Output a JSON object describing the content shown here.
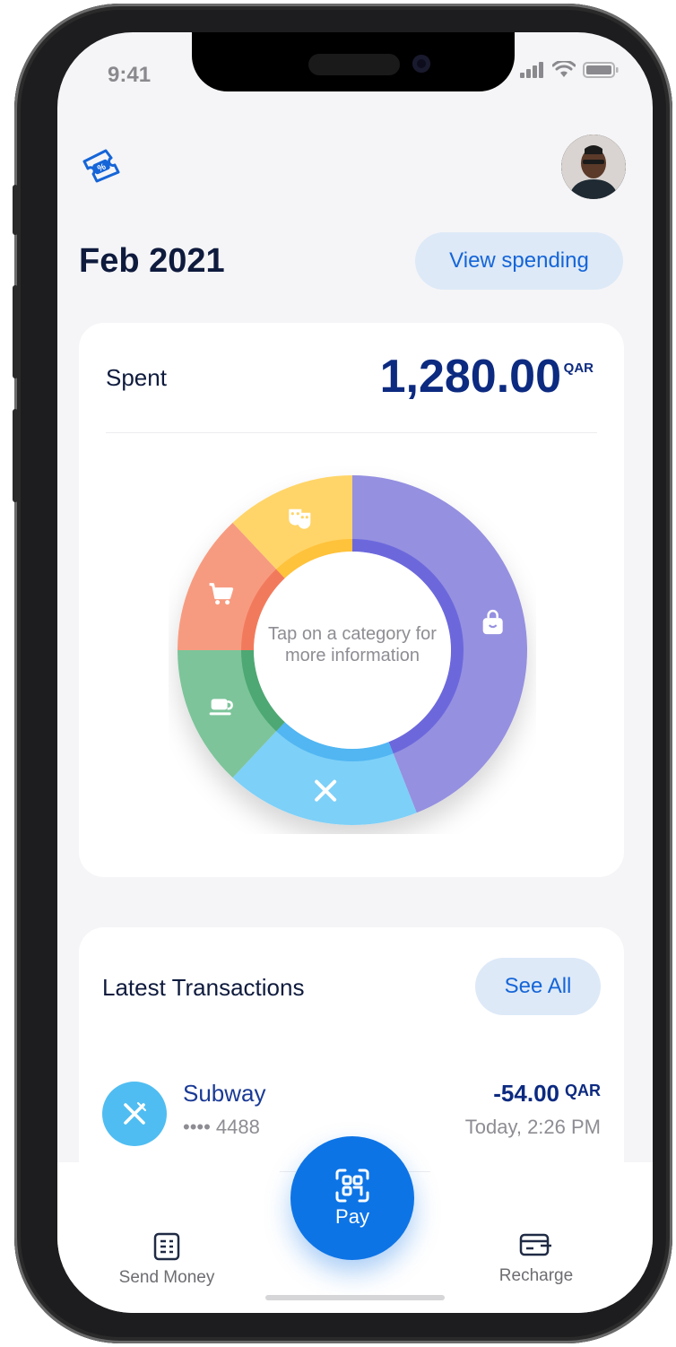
{
  "status_bar": {
    "time": "9:41"
  },
  "header": {
    "coupon_icon": "coupon-percent-icon",
    "avatar": "user-avatar",
    "month": "Feb 2021",
    "view_spending_label": "View spending"
  },
  "spent_card": {
    "label": "Spent",
    "amount": "1,280.00",
    "currency": "QAR",
    "hint": "Tap on a category for more information"
  },
  "chart_data": {
    "type": "pie",
    "categories": [
      "Shopping",
      "Restaurants",
      "Cafes",
      "Groceries",
      "Entertainment"
    ],
    "icons": [
      "shopping-bag-icon",
      "fork-knife-icon",
      "coffee-cup-icon",
      "shopping-cart-icon",
      "theater-masks-icon"
    ],
    "values": [
      44,
      18,
      13,
      13,
      12
    ],
    "colors": [
      "#9590e0",
      "#7dd0f8",
      "#7dc49a",
      "#f79b80",
      "#ffd569"
    ],
    "inner_colors": [
      "#6c68dc",
      "#51b6f2",
      "#4ea873",
      "#f27a5c",
      "#ffc23b"
    ]
  },
  "transactions": {
    "title": "Latest Transactions",
    "see_all_label": "See All",
    "items": [
      {
        "merchant": "Subway",
        "card": "•••• 4488",
        "amount": "-54.00",
        "currency": "QAR",
        "time": "Today, 2:26 PM",
        "icon": "fork-knife-icon",
        "icon_color": "#4fbdf1"
      }
    ]
  },
  "bottom_nav": {
    "send_money_label": "Send Money",
    "pay_label": "Pay",
    "recharge_label": "Recharge"
  },
  "colors": {
    "primary": "#0d74e6",
    "navy": "#0c2a80",
    "chip_bg": "#dde9f7",
    "background": "#f5f5f7"
  }
}
